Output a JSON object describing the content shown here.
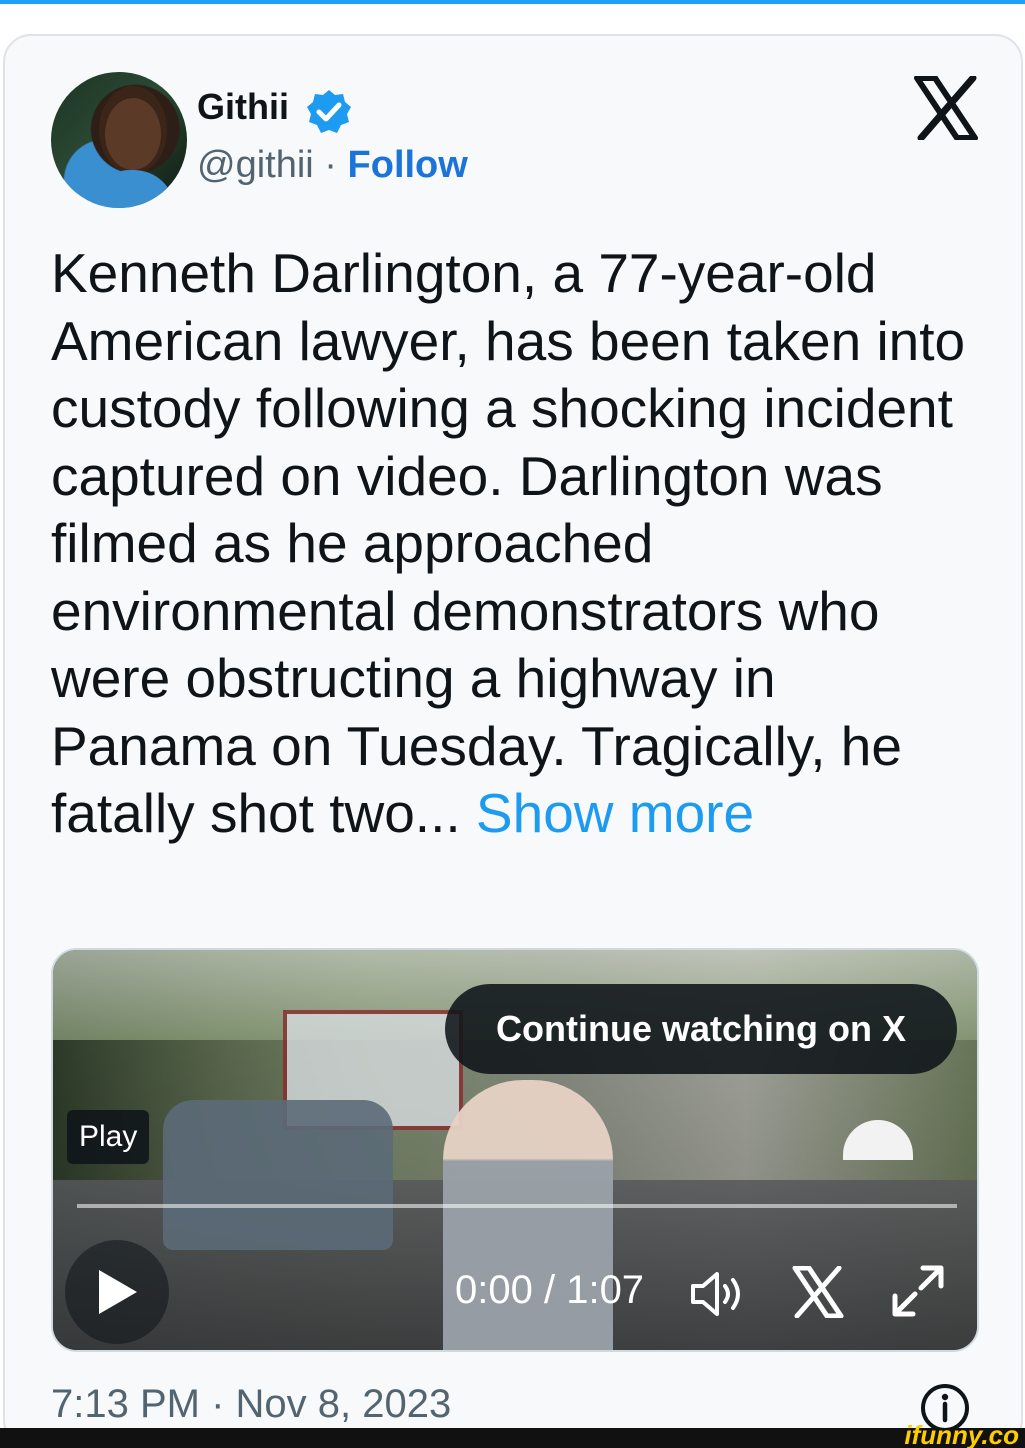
{
  "tweet": {
    "author": {
      "name": "Githii",
      "handle": "@githii",
      "separator": " · ",
      "follow_label": "Follow",
      "verified": true
    },
    "platform_icon": "x-logo-icon",
    "text": "Kenneth Darlington, a 77-year-old American lawyer, has been taken into custody following a shocking incident captured on video. Darlington was filmed as he approached environmental demonstrators who were obstructing a highway in Panama on Tuesday. Tragically, he fatally shot two... ",
    "show_more_label": "Show more",
    "timestamp": "7:13 PM · Nov 8, 2023"
  },
  "video": {
    "continue_label": "Continue watching on X",
    "play_tooltip": "Play",
    "time_current": "0:00",
    "time_separator": " / ",
    "time_total": "1:07",
    "progress": 0
  },
  "watermark": {
    "text": "ifunny.co"
  },
  "colors": {
    "accent": "#1d9bf0",
    "follow": "#1d74d8",
    "text": "#0f1419",
    "muted": "#536471",
    "top_rule": "#1da1f2"
  }
}
